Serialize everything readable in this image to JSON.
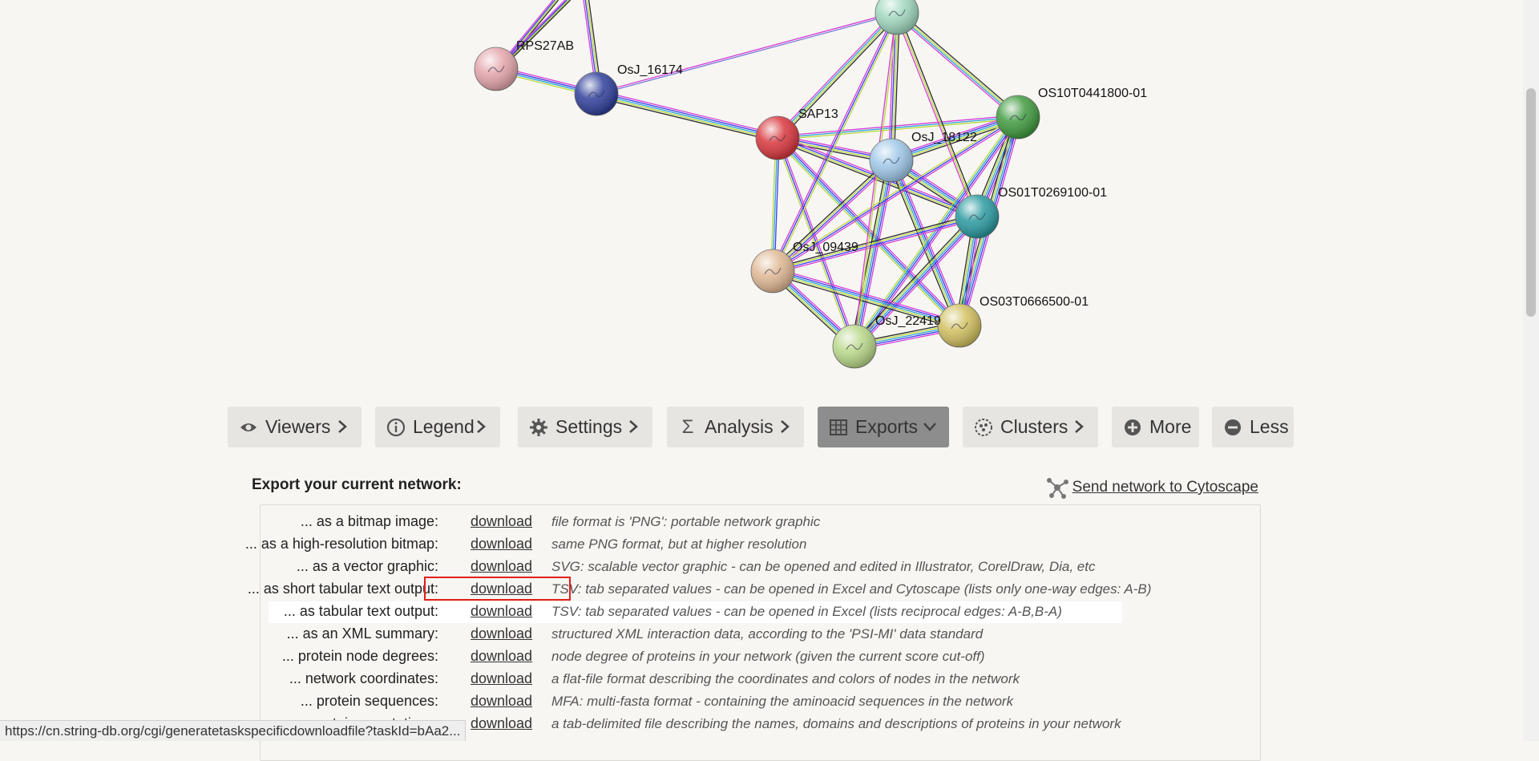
{
  "network": {
    "nodes": [
      {
        "name": "RPS27AB",
        "color": "#e3a5ab"
      },
      {
        "name": "OsJ_16174",
        "color": "#2f3f9a"
      },
      {
        "name": "SAP13",
        "color": "#d8363d"
      },
      {
        "name": "OsJ_18122",
        "color": "#9fc7e8"
      },
      {
        "name": "OS10T0441800-01",
        "color": "#3f9a3f"
      },
      {
        "name": "OS01T0269100-01",
        "color": "#2a9aa0"
      },
      {
        "name": "OsJ_09439",
        "color": "#e0b894"
      },
      {
        "name": "OS03T0666500-01",
        "color": "#d1c060"
      },
      {
        "name": "OsJ_22419",
        "color": "#b9d88a"
      },
      {
        "name": "",
        "color": "#9fd8be"
      }
    ]
  },
  "toolbar": {
    "viewers": "Viewers",
    "legend": "Legend",
    "settings": "Settings",
    "analysis": "Analysis",
    "exports": "Exports",
    "clusters": "Clusters",
    "more": "More",
    "less": "Less"
  },
  "exports": {
    "title": "Export your current network:",
    "cytoscape_link": "Send network to Cytoscape",
    "rows": [
      {
        "label": "... as a bitmap image:",
        "link": "download",
        "desc": "file format is 'PNG': portable network graphic"
      },
      {
        "label": "... as a high-resolution bitmap:",
        "link": "download",
        "desc": "same PNG format, but at higher resolution"
      },
      {
        "label": "... as a vector graphic:",
        "link": "download",
        "desc": "SVG: scalable vector graphic - can be opened and edited in Illustrator, CorelDraw, Dia, etc"
      },
      {
        "label": "... as short tabular text output:",
        "link": "download",
        "desc": "TSV: tab separated values - can be opened in Excel and Cytoscape (lists only one-way edges: A-B)"
      },
      {
        "label": "... as tabular text output:",
        "link": "download",
        "desc": "TSV: tab separated values - can be opened in Excel (lists reciprocal edges: A-B,B-A)"
      },
      {
        "label": "... as an XML summary:",
        "link": "download",
        "desc": "structured XML interaction data, according to the 'PSI-MI' data standard"
      },
      {
        "label": "... protein node degrees:",
        "link": "download",
        "desc": "node degree of proteins in your network (given the current score cut-off)"
      },
      {
        "label": "... network coordinates:",
        "link": "download",
        "desc": "a flat-file format describing the coordinates and colors of nodes in the network"
      },
      {
        "label": "... protein sequences:",
        "link": "download",
        "desc": "MFA: multi-fasta format - containing the aminoacid sequences in the network"
      },
      {
        "label": "... protein annotations:",
        "link": "download",
        "desc": "a tab-delimited file describing the names, domains and descriptions of proteins in your network"
      }
    ]
  },
  "status_bar": {
    "url": "https://cn.string-db.org/cgi/generatetaskspecificdownloadfile?taskId=bAa2..."
  }
}
